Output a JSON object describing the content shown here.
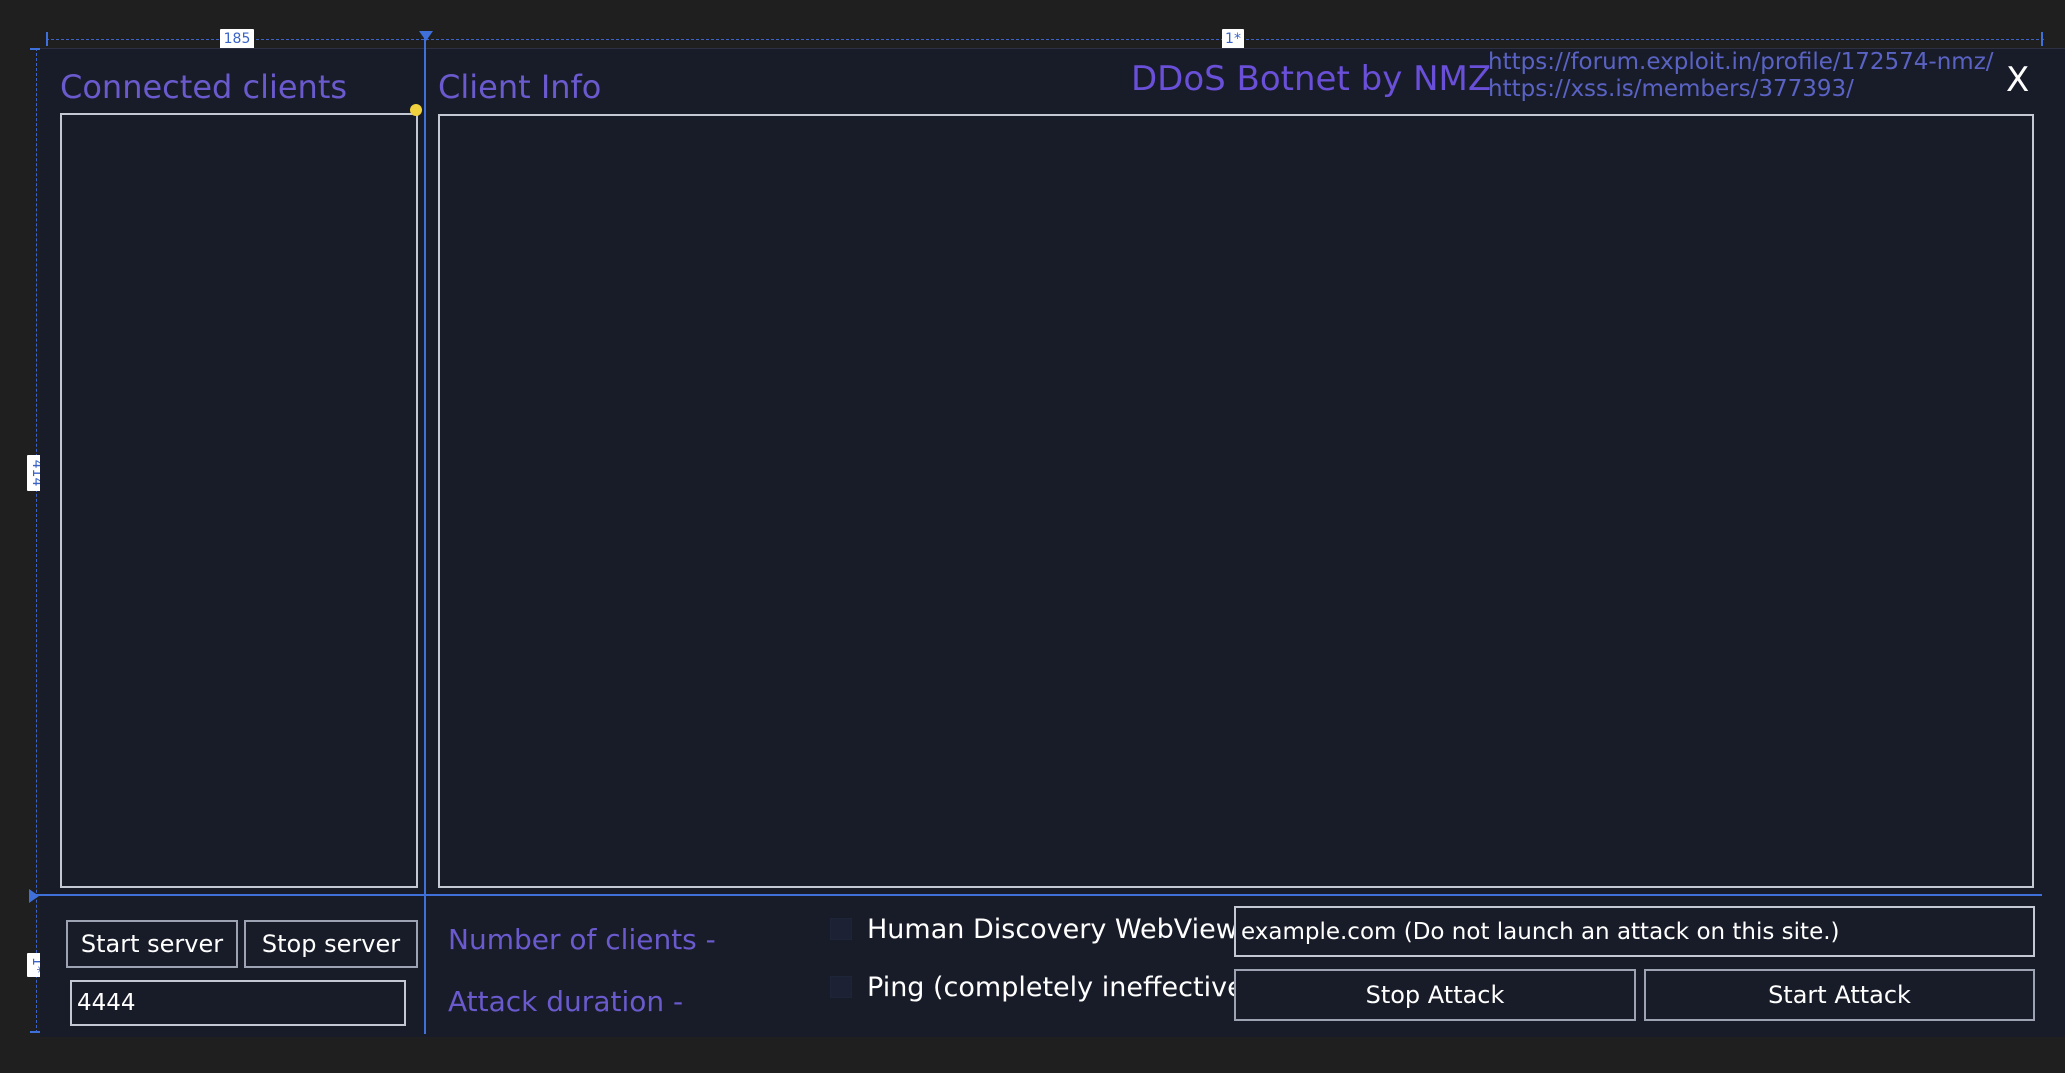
{
  "designer": {
    "column_width_badge": "185",
    "star_width_badge": "1*",
    "row_height_badge": "414",
    "bottom_row_badge": "1*"
  },
  "header": {
    "connected_clients_title": "Connected clients",
    "client_info_title": "Client Info",
    "brand": "DDoS Botnet by NMZ",
    "links": [
      "https://forum.exploit.in/profile/172574-nmz/",
      "https://xss.is/members/377393/"
    ],
    "close_label": "X"
  },
  "server": {
    "start_label": "Start server",
    "stop_label": "Stop server",
    "port_value": "4444"
  },
  "stats": {
    "clients_label": "Number of clients -",
    "duration_label": "Attack duration -"
  },
  "attack": {
    "option_webview_label": "Human Discovery WebView",
    "option_ping_label": "Ping (completely ineffective)",
    "target_value": "example.com (Do not launch an attack on this site.)",
    "stop_label": "Stop Attack",
    "start_label": "Start Attack"
  },
  "colors": {
    "background": "#181c29",
    "accent": "#6a5acd",
    "guide": "#3f6fd8"
  }
}
